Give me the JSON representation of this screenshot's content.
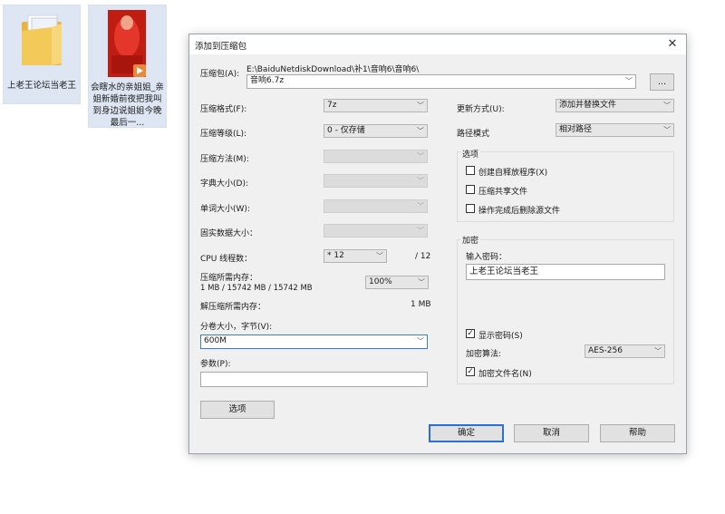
{
  "desktop": {
    "folder_label": "上老王论坛当老王",
    "video_label": "会瞎水的亲姐姐_亲姐新婚前夜把我叫到身边说姐姐今晚最后一..."
  },
  "dialog": {
    "title": "添加到压缩包",
    "close_glyph": "✕",
    "archive_label": "压缩包(A):",
    "archive_path": "E:\\BaiduNetdiskDownload\\补1\\音响6\\音响6\\",
    "archive_name": "音响6.7z",
    "browse_label": "...",
    "left": {
      "format_label": "压缩格式(F):",
      "format_value": "7z",
      "level_label": "压缩等级(L):",
      "level_value": "0 - 仅存储",
      "method_label": "压缩方法(M):",
      "dict_label": "字典大小(D):",
      "word_label": "单词大小(W):",
      "solid_label": "固实数据大小：",
      "cpu_label": "CPU 线程数：",
      "cpu_value": "* 12",
      "cpu_max": "/ 12",
      "mem_label": "压缩所需内存：",
      "mem_detail": "1 MB / 15742 MB / 15742 MB",
      "mem_percent": "100%",
      "demem_label": "解压缩所需内存：",
      "demem_value": "1 MB",
      "volume_label": "分卷大小，字节(V):",
      "volume_value": "600M",
      "params_label": "参数(P):",
      "params_value": "",
      "options_button": "选项"
    },
    "right": {
      "update_label": "更新方式(U):",
      "update_value": "添加并替换文件",
      "path_label": "路径模式",
      "path_value": "相对路径",
      "options_group": "选项",
      "opt_sfx": "创建自释放程序(X)",
      "opt_shared": "压缩共享文件",
      "opt_delete": "操作完成后删除源文件",
      "encrypt_group": "加密",
      "password_label": "输入密码：",
      "password_value": "上老王论坛当老王",
      "show_password": "显示密码(S)",
      "enc_method_label": "加密算法:",
      "enc_method_value": "AES-256",
      "encrypt_names": "加密文件名(N)"
    },
    "ok_button": "确定",
    "cancel_button": "取消",
    "help_button": "帮助"
  },
  "colors": {
    "folder": "#f1c653",
    "video_red": "#d8281c",
    "default_button_border": "#2a6fd6"
  },
  "icons": {
    "folder": "folder-icon",
    "video": "video-thumbnail-icon",
    "checkmark": "✓",
    "dropdown": "chevron-down-icon"
  }
}
